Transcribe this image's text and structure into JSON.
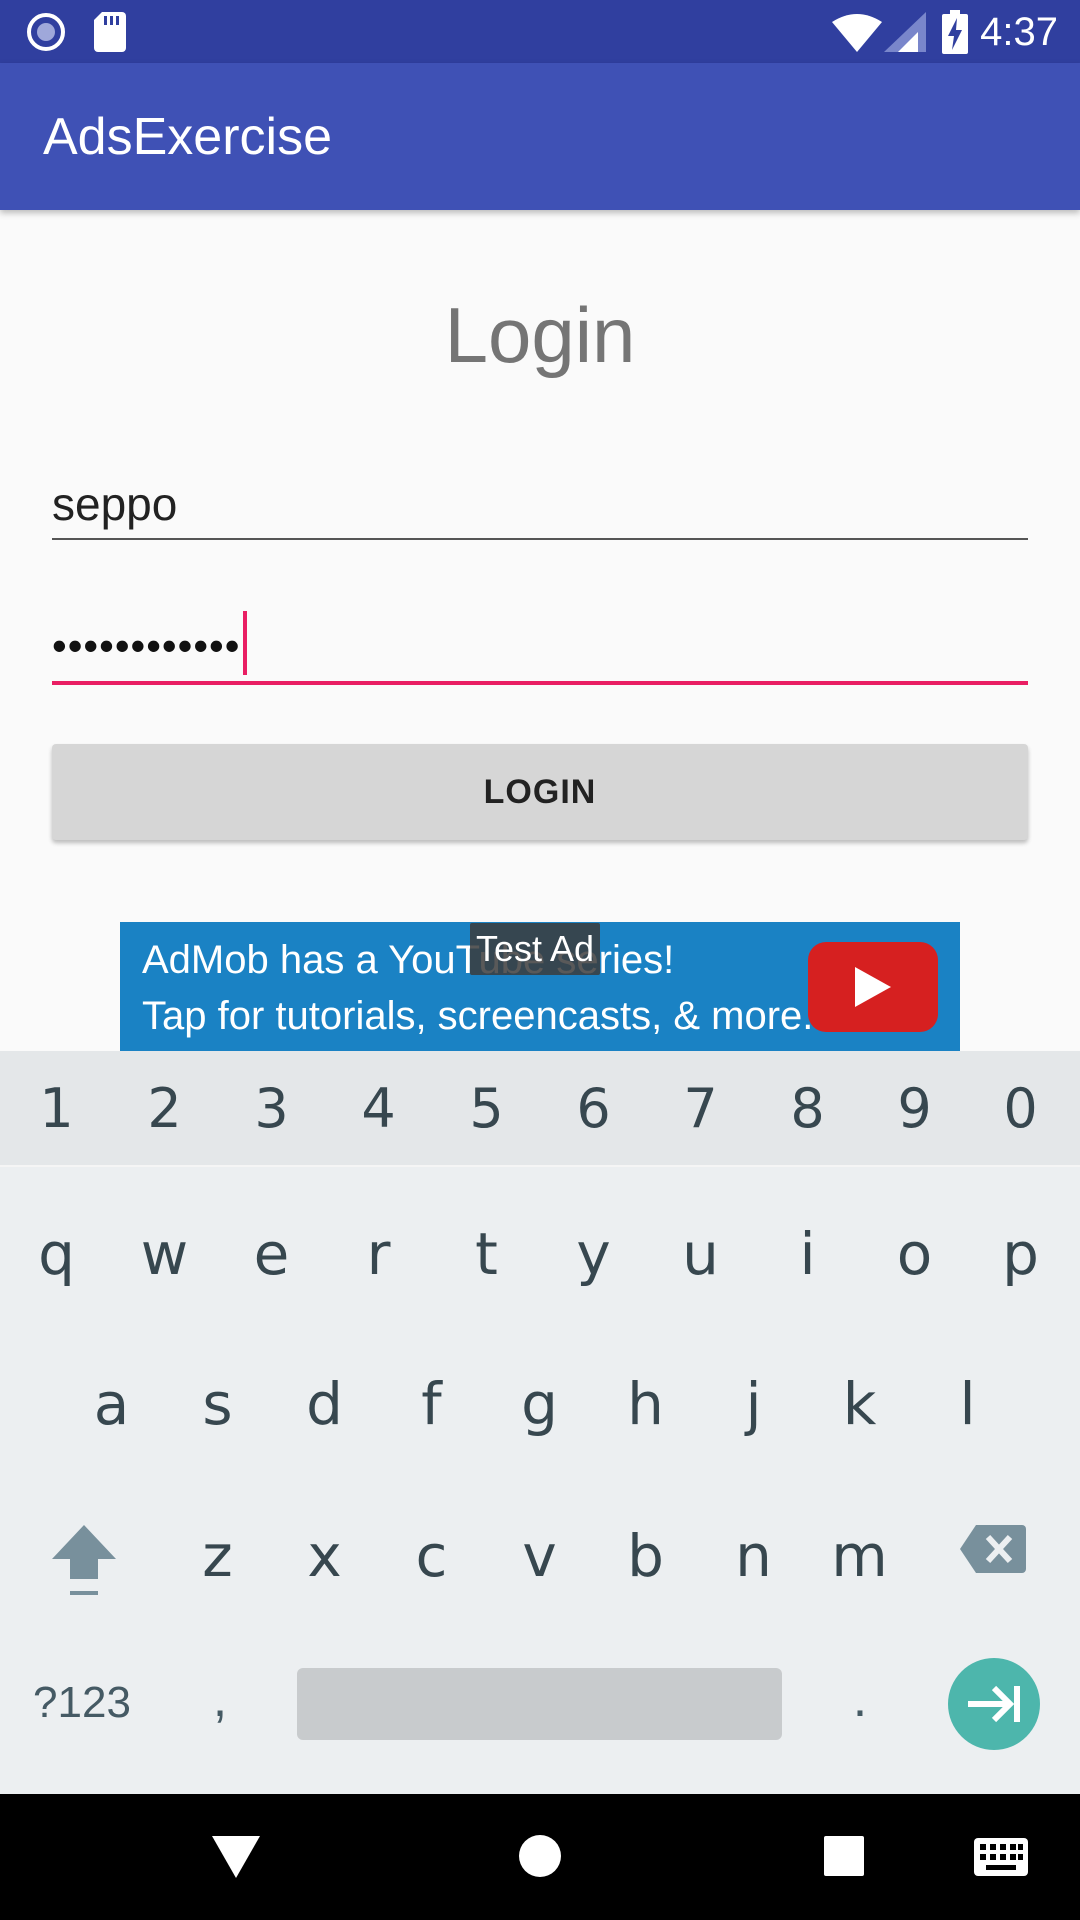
{
  "status_bar": {
    "time": "4:37",
    "left_icons": [
      "record-icon",
      "sd-card-icon"
    ],
    "right_icons": [
      "wifi-icon",
      "cell-signal-icon",
      "battery-charging-icon"
    ],
    "background": "#303f9f"
  },
  "app_bar": {
    "title": "AdsExercise",
    "background": "#3f51b5"
  },
  "login": {
    "heading": "Login",
    "username_value": "seppo",
    "password_value": "••••••••••••",
    "button_label": "LOGIN",
    "focus_color": "#e91e63"
  },
  "ad": {
    "line1": "AdMob has a YouTube series!",
    "line2": "Tap for tutorials, screencasts, & more.",
    "badge": "Test Ad",
    "background": "#1a82c4"
  },
  "keyboard": {
    "numbers": [
      "1",
      "2",
      "3",
      "4",
      "5",
      "6",
      "7",
      "8",
      "9",
      "0"
    ],
    "row1": [
      "q",
      "w",
      "e",
      "r",
      "t",
      "y",
      "u",
      "i",
      "o",
      "p"
    ],
    "row2": [
      "a",
      "s",
      "d",
      "f",
      "g",
      "h",
      "j",
      "k",
      "l"
    ],
    "row3": [
      "z",
      "x",
      "c",
      "v",
      "b",
      "n",
      "m"
    ],
    "symbols_label": "?123",
    "comma": ",",
    "period": ".",
    "enter_color": "#4db6ac"
  },
  "nav_bar": {
    "buttons": [
      "back-icon",
      "home-icon",
      "recents-icon",
      "keyboard-icon"
    ]
  }
}
